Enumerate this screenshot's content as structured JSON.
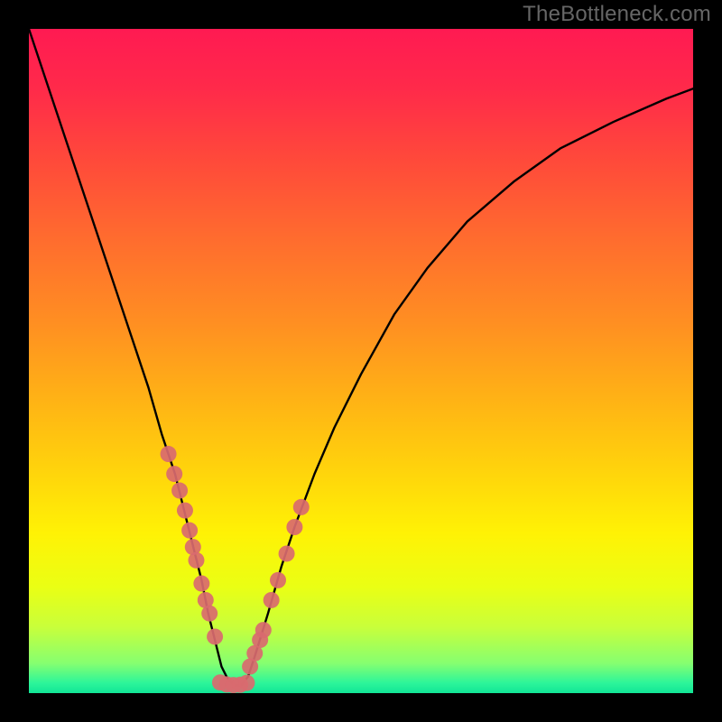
{
  "watermark": "TheBottleneck.com",
  "chart_data": {
    "type": "line",
    "title": "",
    "xlabel": "",
    "ylabel": "",
    "xlim": [
      0,
      100
    ],
    "ylim": [
      0,
      100
    ],
    "curve": {
      "x": [
        0,
        3,
        6,
        9,
        12,
        15,
        18,
        20,
        22,
        24,
        25,
        26,
        27,
        28,
        29,
        30,
        31,
        32,
        33,
        34,
        36,
        38,
        40,
        43,
        46,
        50,
        55,
        60,
        66,
        73,
        80,
        88,
        96,
        100
      ],
      "y": [
        100,
        91,
        82,
        73,
        64,
        55,
        46,
        39,
        33,
        25,
        21,
        17,
        12,
        8,
        4,
        2,
        1.2,
        1.2,
        2.5,
        5.5,
        12,
        19,
        25,
        33,
        40,
        48,
        57,
        64,
        71,
        77,
        82,
        86,
        89.5,
        91
      ]
    },
    "dots_left": {
      "x": [
        21.0,
        21.9,
        22.7,
        23.5,
        24.2,
        24.7,
        25.2,
        26.0,
        26.6,
        27.2,
        28.0
      ],
      "y": [
        36.0,
        33.0,
        30.5,
        27.5,
        24.5,
        22.0,
        20.0,
        16.5,
        14.0,
        12.0,
        8.5
      ]
    },
    "dots_right": {
      "x": [
        33.3,
        34.0,
        34.8,
        35.3,
        36.5,
        37.5,
        38.8,
        40.0,
        41.0
      ],
      "y": [
        4.0,
        6.0,
        8.0,
        9.5,
        14.0,
        17.0,
        21.0,
        25.0,
        28.0
      ]
    },
    "dots_bottom": {
      "x": [
        28.8,
        29.8,
        30.8,
        31.8,
        32.8
      ],
      "y": [
        1.6,
        1.3,
        1.2,
        1.25,
        1.55
      ]
    },
    "dot_style": {
      "r": 9,
      "fill": "#d96a6f",
      "opacity": 0.92
    },
    "gradient_stops": [
      {
        "offset": 0,
        "color": "#ff1a52"
      },
      {
        "offset": 0.09,
        "color": "#ff2a4a"
      },
      {
        "offset": 0.2,
        "color": "#ff4a3a"
      },
      {
        "offset": 0.32,
        "color": "#ff6d2e"
      },
      {
        "offset": 0.44,
        "color": "#ff8e22"
      },
      {
        "offset": 0.55,
        "color": "#ffb016"
      },
      {
        "offset": 0.66,
        "color": "#ffd20c"
      },
      {
        "offset": 0.76,
        "color": "#fff205"
      },
      {
        "offset": 0.84,
        "color": "#eaff14"
      },
      {
        "offset": 0.9,
        "color": "#c9ff3a"
      },
      {
        "offset": 0.955,
        "color": "#86ff70"
      },
      {
        "offset": 0.985,
        "color": "#2cf59a"
      },
      {
        "offset": 1.0,
        "color": "#11e596"
      }
    ]
  }
}
